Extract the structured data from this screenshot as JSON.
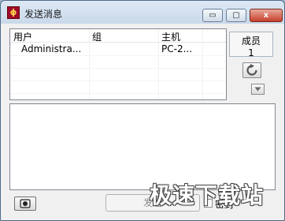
{
  "window": {
    "title": "发送消息"
  },
  "title_buttons": {
    "minimize": "▭",
    "maximize": "▢",
    "close": "x"
  },
  "list": {
    "columns": [
      "用户",
      "组",
      "主机"
    ],
    "rows": [
      {
        "user": "Administra...",
        "group": "",
        "host": "PC-2..."
      }
    ]
  },
  "members": {
    "label": "成员",
    "count": "1"
  },
  "message": {
    "value": ""
  },
  "footer": {
    "send_label": "发送",
    "lock_label": "密封"
  },
  "watermark": "极速下载站",
  "icons": {
    "app": "app-icon",
    "refresh": "refresh-icon",
    "dropdown": "triangle-down-icon",
    "screenshot": "camera-icon"
  },
  "colors": {
    "title_bar": "#c9d9ea",
    "close": "#c6402b"
  }
}
